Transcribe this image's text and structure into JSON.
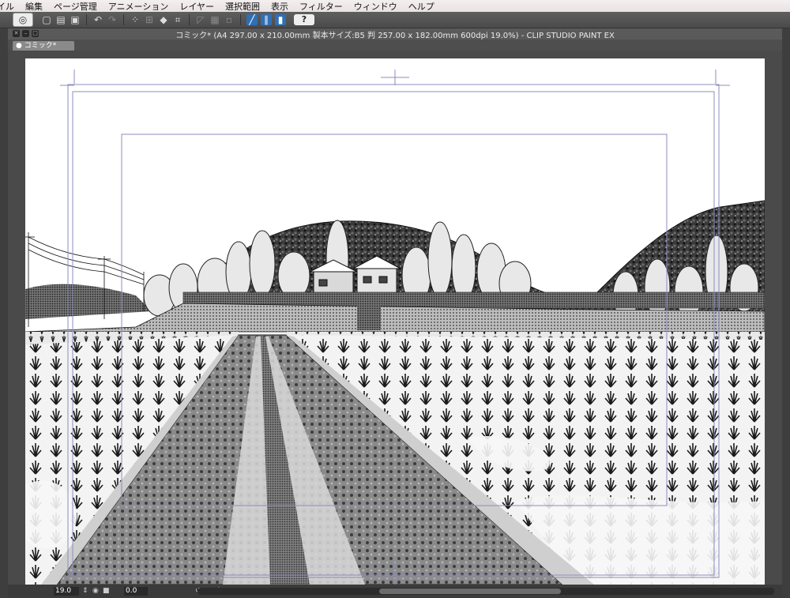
{
  "menu": [
    "イル",
    "編集",
    "ページ管理",
    "アニメーション",
    "レイヤー",
    "選択範囲",
    "表示",
    "フィルター",
    "ウィンドウ",
    "ヘルプ"
  ],
  "toolbar": {
    "icons": [
      "clip-logo-icon",
      "new-file-icon",
      "open-file-icon",
      "save-icon",
      "undo-icon",
      "redo-icon",
      "selection-dots-icon",
      "transform-icon",
      "fill-icon",
      "crop-icon",
      "ruler-icon",
      "grid-icon",
      "snap-icon",
      "perspective-icon",
      "snap-special-icon",
      "help-icon"
    ]
  },
  "window": {
    "title": "コミック* (A4 297.00 x 210.00mm 製本サイズ:B5 判 257.00 x 182.00mm 600dpi 19.0%)  - CLIP STUDIO PAINT EX",
    "tab_label": "コミック*"
  },
  "status": {
    "zoom": "19.0",
    "rotation": "0.0"
  },
  "colors": {
    "menu_bg": "#ece6e6",
    "app_bg": "#4a4a4a",
    "guide_line": "#8c8cbf"
  }
}
